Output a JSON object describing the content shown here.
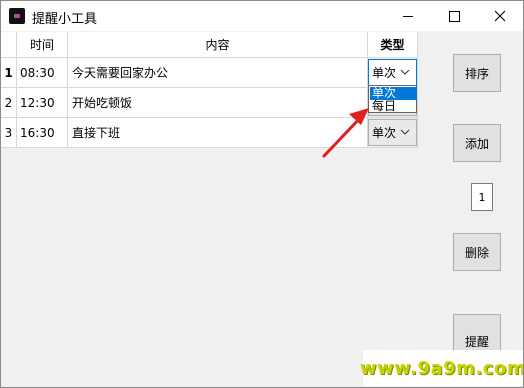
{
  "window": {
    "title": "提醒小工具"
  },
  "table": {
    "headers": {
      "time": "时间",
      "content": "内容",
      "type": "类型"
    },
    "rows": [
      {
        "num": "1",
        "time": "08:30",
        "content": "今天需要回家办公",
        "type": "单次"
      },
      {
        "num": "2",
        "time": "12:30",
        "content": "开始吃顿饭",
        "type": "单次"
      },
      {
        "num": "3",
        "time": "16:30",
        "content": "直接下班",
        "type": "单次"
      }
    ],
    "type_options": [
      "单次",
      "每日"
    ]
  },
  "buttons": {
    "sort": "排序",
    "add": "添加",
    "delete": "删除",
    "partial": "提醒"
  },
  "row_index_input": "1",
  "watermark": "www.9a9m.com",
  "colors": {
    "selection": "#0078d7",
    "arrow": "#e02020",
    "watermark": "#c8d400"
  },
  "icons": [
    "app-icon",
    "minimize-icon",
    "maximize-icon",
    "close-icon",
    "chevron-down-icon",
    "arrow-annotation"
  ]
}
